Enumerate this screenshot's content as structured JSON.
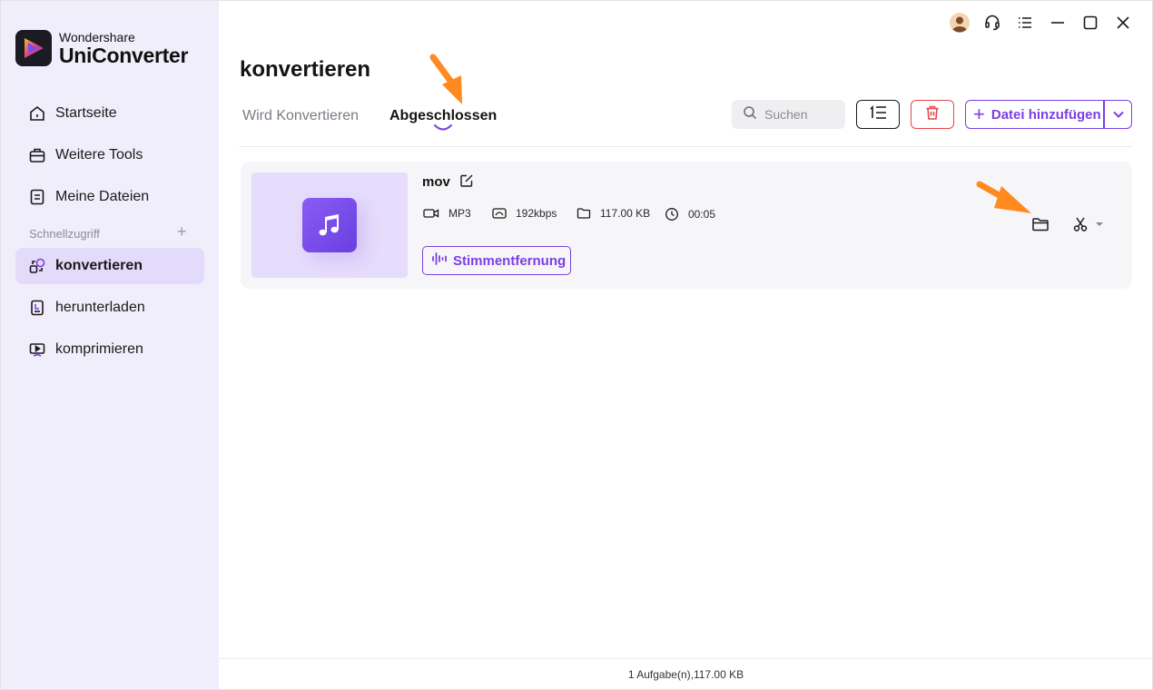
{
  "brand": {
    "small": "Wondershare",
    "big": "UniConverter"
  },
  "sidebar": {
    "items": [
      {
        "label": "Startseite"
      },
      {
        "label": "Weitere Tools"
      },
      {
        "label": "Meine Dateien"
      }
    ],
    "section_label": "Schnellzugriff",
    "section_plus": "+",
    "quick_items": [
      {
        "label": "konvertieren",
        "active": true
      },
      {
        "label": "herunterladen"
      },
      {
        "label": "komprimieren"
      }
    ]
  },
  "header": {
    "title": "konvertieren"
  },
  "tabs": [
    {
      "label": "Wird Konvertieren"
    },
    {
      "label": "Abgeschlossen",
      "active": true
    }
  ],
  "search": {
    "placeholder": "Suchen"
  },
  "toolbar": {
    "add_label": "Datei hinzufügen"
  },
  "file": {
    "name": "mov",
    "format": "MP3",
    "bitrate": "192kbps",
    "size": "117.00 KB",
    "duration": "00:05",
    "voice_button": "Stimmentfernung"
  },
  "status": {
    "text": "1 Aufgabe(n),117.00 KB"
  },
  "colors": {
    "accent": "#7b3fe4",
    "sidebar_bg": "#f1eefb",
    "danger": "#e5484d",
    "annotation": "#ff8a1f"
  }
}
